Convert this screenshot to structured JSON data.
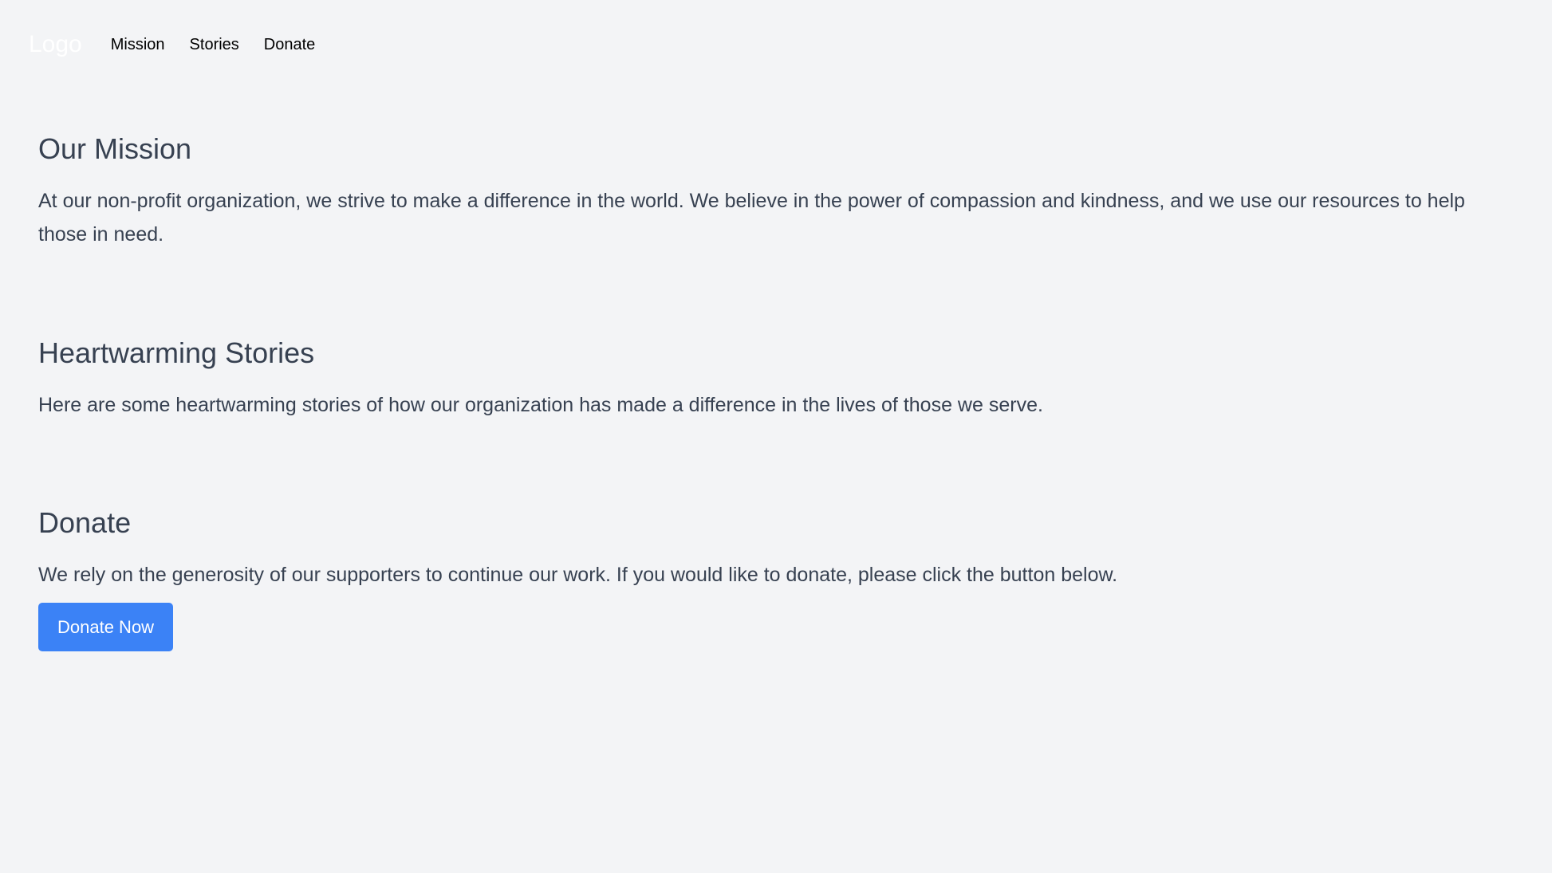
{
  "header": {
    "logo": "Logo",
    "nav": [
      {
        "label": "Mission"
      },
      {
        "label": "Stories"
      },
      {
        "label": "Donate"
      }
    ]
  },
  "sections": {
    "mission": {
      "title": "Our Mission",
      "body": "At our non-profit organization, we strive to make a difference in the world. We believe in the power of compassion and kindness, and we use our resources to help those in need."
    },
    "stories": {
      "title": "Heartwarming Stories",
      "body": "Here are some heartwarming stories of how our organization has made a difference in the lives of those we serve."
    },
    "donate": {
      "title": "Donate",
      "body": "We rely on the generosity of our supporters to continue our work. If you would like to donate, please click the button below.",
      "button_label": "Donate Now"
    }
  },
  "colors": {
    "background": "#f3f4f6",
    "text": "#374151",
    "accent": "#3b82f6"
  }
}
